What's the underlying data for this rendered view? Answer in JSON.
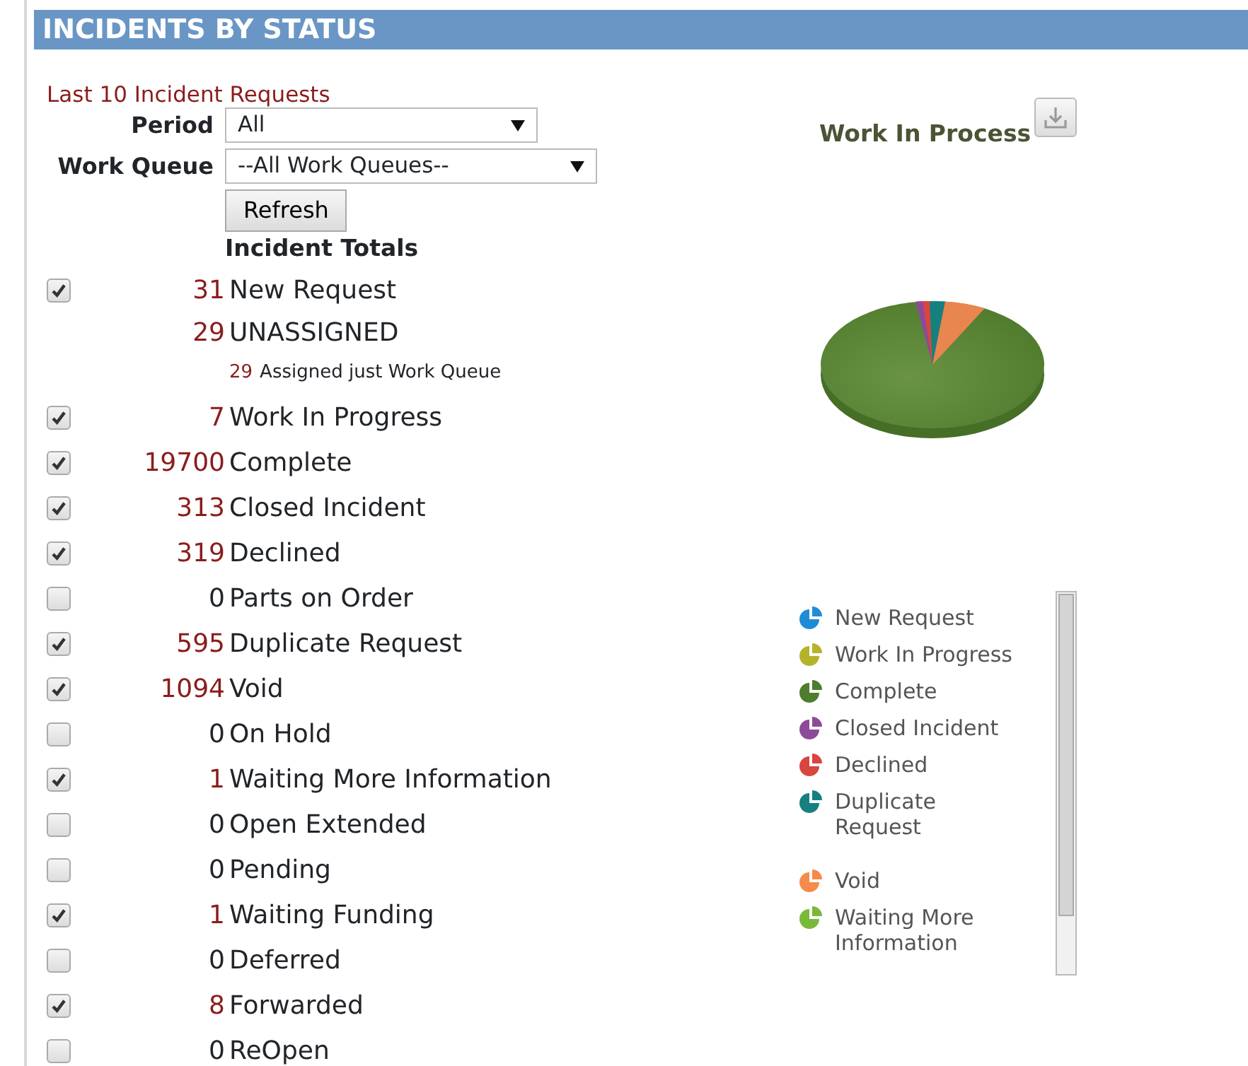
{
  "header": {
    "title": "INCIDENTS BY STATUS"
  },
  "filters": {
    "caption": "Last 10 Incident Requests",
    "period": {
      "label": "Period",
      "value": "All"
    },
    "work_queue": {
      "label": "Work Queue",
      "value": "--All Work Queues--"
    },
    "refresh": "Refresh",
    "totals_heading": "Incident Totals"
  },
  "rows": [
    {
      "kind": "status",
      "checked": true,
      "count": "31",
      "label": "New Request",
      "highlighted": true
    },
    {
      "kind": "sub",
      "count": "29",
      "label": "UNASSIGNED",
      "highlighted": true
    },
    {
      "kind": "detail",
      "count": "29",
      "label": "Assigned just Work Queue",
      "highlighted": true
    },
    {
      "kind": "status",
      "checked": true,
      "count": "7",
      "label": "Work In Progress",
      "highlighted": true
    },
    {
      "kind": "status",
      "checked": true,
      "count": "19700",
      "label": "Complete",
      "highlighted": true
    },
    {
      "kind": "status",
      "checked": true,
      "count": "313",
      "label": "Closed Incident",
      "highlighted": true
    },
    {
      "kind": "status",
      "checked": true,
      "count": "319",
      "label": "Declined",
      "highlighted": true
    },
    {
      "kind": "status",
      "checked": false,
      "count": "0",
      "label": "Parts on Order",
      "highlighted": false
    },
    {
      "kind": "status",
      "checked": true,
      "count": "595",
      "label": "Duplicate Request",
      "highlighted": true
    },
    {
      "kind": "status",
      "checked": true,
      "count": "1094",
      "label": "Void",
      "highlighted": true
    },
    {
      "kind": "status",
      "checked": false,
      "count": "0",
      "label": "On Hold",
      "highlighted": false
    },
    {
      "kind": "status",
      "checked": true,
      "count": "1",
      "label": "Waiting More Information",
      "highlighted": true
    },
    {
      "kind": "status",
      "checked": false,
      "count": "0",
      "label": "Open Extended",
      "highlighted": false
    },
    {
      "kind": "status",
      "checked": false,
      "count": "0",
      "label": "Pending",
      "highlighted": false
    },
    {
      "kind": "status",
      "checked": true,
      "count": "1",
      "label": "Waiting Funding",
      "highlighted": true
    },
    {
      "kind": "status",
      "checked": false,
      "count": "0",
      "label": "Deferred",
      "highlighted": false
    },
    {
      "kind": "status",
      "checked": true,
      "count": "8",
      "label": "Forwarded",
      "highlighted": true
    },
    {
      "kind": "status",
      "checked": false,
      "count": "0",
      "label": "ReOpen",
      "highlighted": false
    }
  ],
  "chart": {
    "title": "Work In Process",
    "legend": [
      {
        "label": "New Request",
        "color": "#1f8dd6"
      },
      {
        "label": "Work In Progress",
        "color": "#b5b32a"
      },
      {
        "label": "Complete",
        "color": "#4e7d2e"
      },
      {
        "label": "Closed Incident",
        "color": "#8e4a9a"
      },
      {
        "label": "Declined",
        "color": "#d9453f"
      },
      {
        "label": "Duplicate Request",
        "color": "#16807f"
      },
      {
        "label": "Void",
        "color": "#f58a4a"
      },
      {
        "label": "Waiting More Information",
        "color": "#7ab83a"
      }
    ]
  }
}
